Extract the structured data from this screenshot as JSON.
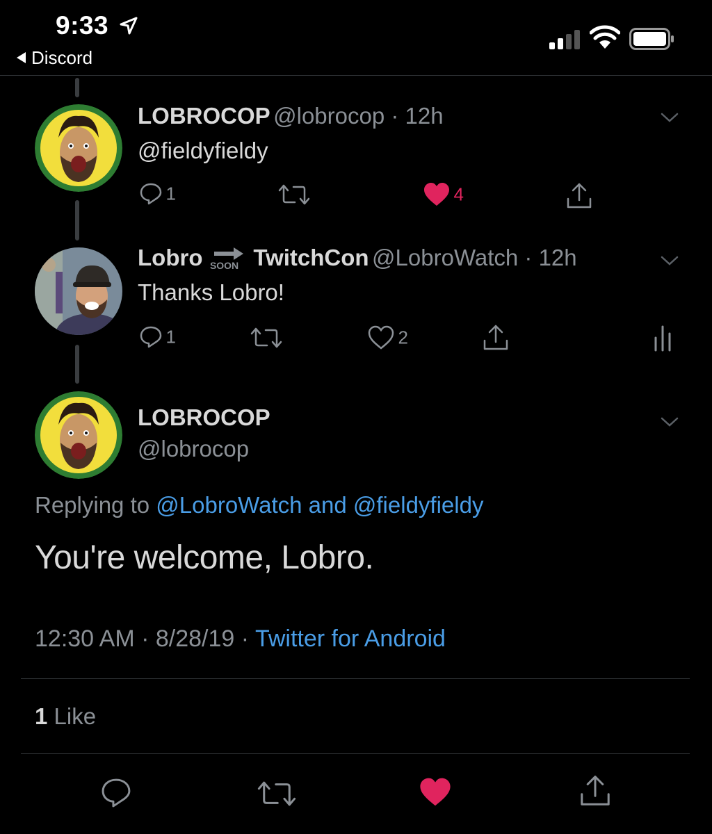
{
  "status_bar": {
    "time": "9:33",
    "back_app": "Discord"
  },
  "tweets": [
    {
      "name": "LOBROCOP",
      "handle": "@lobrocop",
      "time": "12h",
      "text": "@fieldyfieldy",
      "reply_count": "1",
      "like_count": "4",
      "liked": true
    },
    {
      "name_part1": "Lobro",
      "name_badge": "SOON",
      "name_part2": "TwitchCon",
      "handle": "@LobroWatch",
      "time": "12h",
      "text": "Thanks Lobro!",
      "reply_count": "1",
      "like_count": "2",
      "liked": false
    }
  ],
  "main_tweet": {
    "name": "LOBROCOP",
    "handle": "@lobrocop",
    "replying_prefix": "Replying to",
    "replying_user1": "@LobroWatch",
    "replying_and": "and",
    "replying_user2": "@fieldyfieldy",
    "text": "You're welcome, Lobro.",
    "time": "12:30 AM",
    "date": "8/28/19",
    "source": "Twitter for Android",
    "likes_count": "1",
    "likes_label": "Like"
  },
  "colors": {
    "accent": "#4a9de6",
    "like": "#e0245e",
    "background": "#000000"
  },
  "icons": [
    "location-arrow-icon",
    "signal-icon",
    "wifi-icon",
    "battery-icon",
    "chevron-down-icon",
    "reply-icon",
    "retweet-icon",
    "heart-icon",
    "share-icon",
    "analytics-icon"
  ]
}
